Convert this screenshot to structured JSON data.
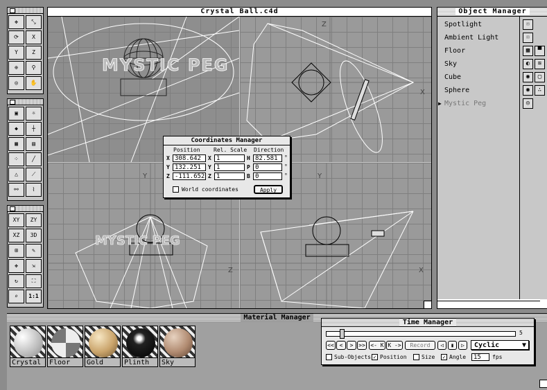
{
  "main_window": {
    "title": "Crystal Ball.c4d"
  },
  "viewports": {
    "top_right_axes": {
      "z": "Z",
      "x": "X"
    },
    "bottom_left_axes": {
      "y": "Y",
      "z": "Z"
    },
    "bottom_right_axes": {
      "y": "Y",
      "x": "X"
    },
    "text_objects": {
      "perspective": "MYSTIC PEG",
      "front": "MYSTIC PEG"
    }
  },
  "object_manager": {
    "title": "Object Manager",
    "objects": [
      {
        "name": "Spotlight"
      },
      {
        "name": "Ambient Light"
      },
      {
        "name": "Floor"
      },
      {
        "name": "Sky"
      },
      {
        "name": "Cube"
      },
      {
        "name": "Sphere"
      },
      {
        "name": "Mystic Peg"
      }
    ],
    "expand_icon": "triangle-right-icon"
  },
  "coordinates_manager": {
    "title": "Coordinates Manager",
    "headers": {
      "position": "Position",
      "scale": "Rel. Scale",
      "direction": "Direction"
    },
    "position": [
      {
        "axis": "X",
        "value": "308.642"
      },
      {
        "axis": "Y",
        "value": "132.251"
      },
      {
        "axis": "Z",
        "value": "-111.652"
      }
    ],
    "scale": [
      {
        "axis": "X",
        "value": "1"
      },
      {
        "axis": "Y",
        "value": "1"
      },
      {
        "axis": "Z",
        "value": "1"
      }
    ],
    "direction": [
      {
        "axis": "H",
        "value": "82.581"
      },
      {
        "axis": "P",
        "value": "0"
      },
      {
        "axis": "B",
        "value": "0"
      }
    ],
    "degree_symbol": "°",
    "world_coordinates_label": "World coordinates",
    "apply_label": "Apply"
  },
  "material_manager": {
    "title": "Material Manager",
    "materials": [
      {
        "name": "Crystal",
        "color": "#ffffff"
      },
      {
        "name": "Floor",
        "color": "#9a9a9a"
      },
      {
        "name": "Gold",
        "color": "#c9a36a"
      },
      {
        "name": "Plinth",
        "color": "#111111"
      },
      {
        "name": "Sky",
        "color": "#b08a70"
      }
    ]
  },
  "time_manager": {
    "title": "Time Manager",
    "frame": "5",
    "slider_fraction": 0.08,
    "buttons": {
      "first": "<<",
      "prev": "<",
      "next": ">",
      "last": ">>",
      "prev_key": "<- K",
      "next_key": "K ->",
      "record": "Record",
      "play_back": "◁",
      "stop": "▮",
      "play": "▷"
    },
    "mode": "Cyclic",
    "checkboxes": [
      {
        "label": "Sub-Objects",
        "checked": false
      },
      {
        "label": "Position",
        "checked": true
      },
      {
        "label": "Size",
        "checked": false
      },
      {
        "label": "Angle",
        "checked": true
      }
    ],
    "fps_value": "15",
    "fps_label": "fps"
  },
  "tool_palettes": {
    "palette1": [
      "move-objects-icon",
      "scale-objects-icon",
      "rotate-objects-icon",
      "lock-x-icon",
      "lock-y-icon",
      "lock-z-icon",
      "object-axis-icon",
      "world-axis-icon",
      "camera-icon",
      "mouse-icon"
    ],
    "palette2": [
      "camera-view-icon",
      "light-view-icon",
      "object-tool-icon",
      "axis-tool-icon",
      "texture-tool-icon",
      "texture-axis-icon",
      "point-tool-icon",
      "edge-tool-icon",
      "polygon-tool-icon",
      "bone-tool-icon",
      "inverse-kinematics-icon",
      "deform-icon"
    ],
    "palette3": [
      {
        "icon": "view-xy-icon",
        "label": "XY"
      },
      {
        "icon": "view-zy-icon",
        "label": "ZY"
      },
      {
        "icon": "view-xz-icon",
        "label": "XZ"
      },
      {
        "icon": "view-3d-icon",
        "label": "3D"
      },
      {
        "icon": "four-views-icon",
        "label": ""
      },
      {
        "icon": "pencil-icon",
        "label": ""
      },
      {
        "icon": "move-view-icon",
        "label": ""
      },
      {
        "icon": "scale-view-icon",
        "label": ""
      },
      {
        "icon": "rotate-view-icon",
        "label": ""
      },
      {
        "icon": "fit-view-icon",
        "label": ""
      },
      {
        "icon": "magnifier-icon",
        "label": ""
      },
      {
        "icon": "one-to-one-icon",
        "label": "1:1"
      }
    ]
  }
}
